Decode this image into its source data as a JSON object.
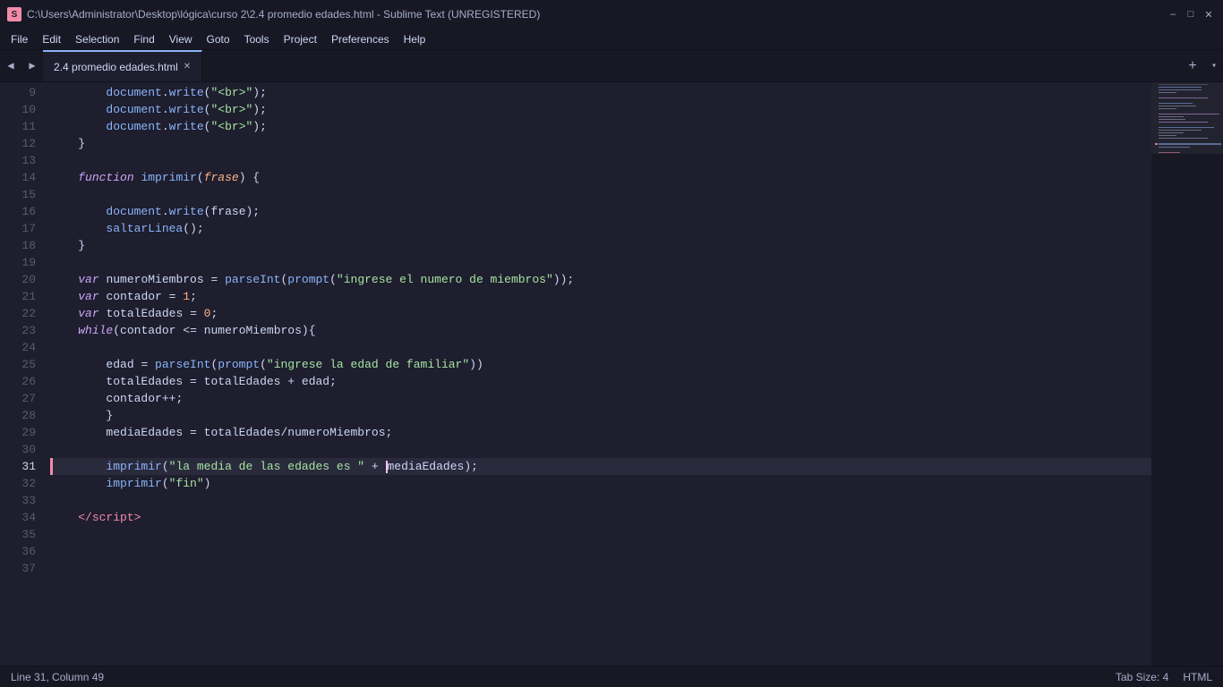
{
  "titlebar": {
    "icon": "S",
    "text": "C:\\Users\\Administrator\\Desktop\\lógica\\curso 2\\2.4 promedio edades.html - Sublime Text (UNREGISTERED)",
    "minimize": "–",
    "maximize": "□",
    "close": "✕"
  },
  "menubar": {
    "items": [
      "File",
      "Edit",
      "Selection",
      "Find",
      "View",
      "Goto",
      "Tools",
      "Project",
      "Preferences",
      "Help"
    ]
  },
  "tabbar": {
    "tab_label": "2.4 promedio edades.html",
    "add_btn": "+",
    "dropdown": "▾"
  },
  "status": {
    "position": "Line 31, Column 49",
    "tab_size": "Tab Size: 4",
    "language": "HTML"
  },
  "lines": {
    "start": 9,
    "active": 31
  }
}
